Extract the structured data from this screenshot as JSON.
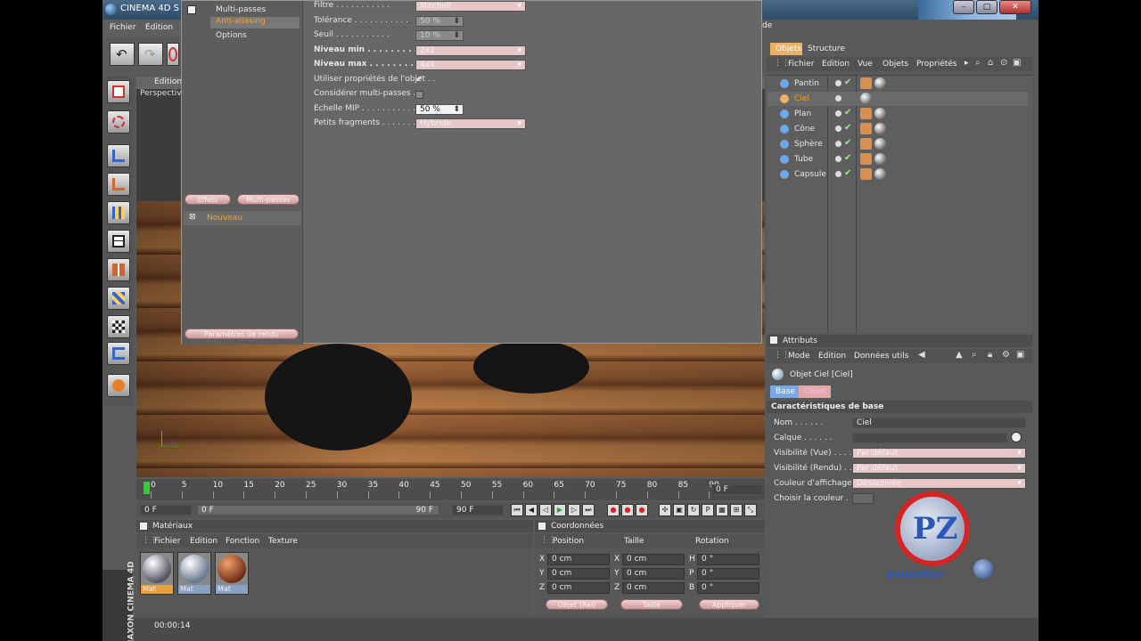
{
  "app": {
    "title": "CINEMA 4D S",
    "right_title_fragment": "de"
  },
  "menubar": {
    "items": [
      "Fichier",
      "Edition"
    ]
  },
  "viewport": {
    "header": "Edition",
    "view_name": "Perspective"
  },
  "render_dialog": {
    "tree": {
      "multi_passes": "Multi-passes",
      "antialiasing": "Anti-aliasing",
      "options": "Options",
      "nouveau": "Nouveau"
    },
    "buttons": {
      "left1": "Effets",
      "left2": "Multi-passes",
      "bottom": "Paramètres de rendu"
    },
    "settings": [
      {
        "label": "Filtre",
        "value": "Mitchell",
        "bold": false,
        "type": "select"
      },
      {
        "label": "Tolérance",
        "value": "50 %",
        "bold": false,
        "type": "num"
      },
      {
        "label": "Seuil",
        "value": "10 %",
        "bold": false,
        "type": "num"
      },
      {
        "label": "Niveau min",
        "value": "2x2",
        "bold": true,
        "type": "select"
      },
      {
        "label": "Niveau max",
        "value": "4x4",
        "bold": true,
        "type": "select"
      },
      {
        "label": "Utiliser propriétés de l'objet",
        "value": "✔",
        "bold": false,
        "type": "check"
      },
      {
        "label": "Considérer multi-passes",
        "value": "",
        "bold": false,
        "type": "check"
      },
      {
        "label": "Echelle MIP",
        "value": "50 %",
        "bold": false,
        "type": "numwhite"
      },
      {
        "label": "Petits fragments",
        "value": "Hybride",
        "bold": false,
        "type": "select"
      }
    ]
  },
  "object_manager": {
    "tabs": [
      "Objets",
      "Structure"
    ],
    "menu": [
      "Fichier",
      "Edition",
      "Vue",
      "Objets",
      "Propriétés"
    ],
    "objects": [
      {
        "name": "Pantin",
        "color": "#6aa8e8"
      },
      {
        "name": "Ciel",
        "color": "#e8b068"
      },
      {
        "name": "Plan",
        "color": "#6aa8e8"
      },
      {
        "name": "Cône",
        "color": "#6aa8e8"
      },
      {
        "name": "Sphère",
        "color": "#6aa8e8"
      },
      {
        "name": "Tube",
        "color": "#6aa8e8"
      },
      {
        "name": "Capsule",
        "color": "#6aa8e8"
      }
    ]
  },
  "attributes": {
    "title": "Attributs",
    "menu": [
      "Mode",
      "Edition",
      "Données utils"
    ],
    "object_label": "Objet Ciel [Ciel]",
    "tabs": [
      "Base",
      "Objet"
    ],
    "section": "Caractéristiques de base",
    "fields": [
      {
        "label": "Nom",
        "value": "Ciel"
      },
      {
        "label": "Calque",
        "value": ""
      },
      {
        "label": "Visibilité (Vue)",
        "value": "Par défaut"
      },
      {
        "label": "Visibilité (Rendu)",
        "value": "Par défaut"
      },
      {
        "label": "Couleur d'affichage",
        "value": "Désactivée"
      },
      {
        "label": "Choisir la couleur",
        "value": ""
      }
    ]
  },
  "timeline": {
    "ticks": [
      "0",
      "5",
      "10",
      "15",
      "20",
      "25",
      "30",
      "35",
      "40",
      "45",
      "50",
      "55",
      "60",
      "65",
      "70",
      "75",
      "80",
      "85",
      "90"
    ],
    "current_frame": "0 F"
  },
  "transport": {
    "start": "0 F",
    "range_start": "0 F",
    "range_end": "90 F",
    "end": "90 F"
  },
  "materials": {
    "title": "Matériaux",
    "menu": [
      "Fichier",
      "Edition",
      "Fonction",
      "Texture"
    ],
    "items": [
      {
        "name": "Mat",
        "style": "radial-gradient(circle at 35% 30%, #fff, #556 70%)"
      },
      {
        "name": "Mat",
        "style": "radial-gradient(circle at 35% 30%, #fff, #6a7a90 70%)"
      },
      {
        "name": "Mat",
        "style": "radial-gradient(circle at 35% 30%, #f0a070, #6a2a10 75%)"
      }
    ]
  },
  "coordinates": {
    "title": "Coordonnées",
    "headers": [
      "Position",
      "Taille",
      "Rotation"
    ],
    "rows": [
      {
        "axis": "X",
        "pos": "0 cm",
        "size_axis": "X",
        "size": "0 cm",
        "rot_axis": "H",
        "rot": "0 °"
      },
      {
        "axis": "Y",
        "pos": "0 cm",
        "size_axis": "Y",
        "size": "0 cm",
        "rot_axis": "P",
        "rot": "0 °"
      },
      {
        "axis": "Z",
        "pos": "0 cm",
        "size_axis": "Z",
        "size": "0 cm",
        "rot_axis": "B",
        "rot": "0 °"
      }
    ],
    "mode1": "Objet (Rel)",
    "mode2": "Taille",
    "apply": "Appliquer"
  },
  "status": {
    "time": "00:00:14",
    "maxon": "MAXON CINEMA 4D"
  },
  "watermark": {
    "mark": "PZ",
    "word": "pouzolles"
  }
}
